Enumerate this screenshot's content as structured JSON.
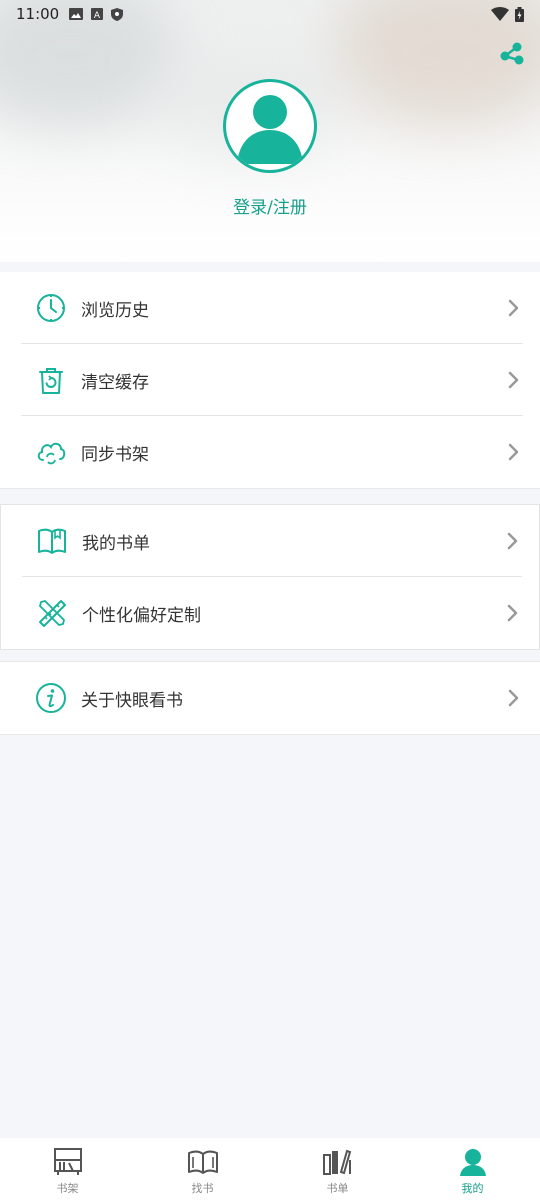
{
  "status_bar": {
    "time": "11:00",
    "left_icons": [
      "image-icon",
      "a-icon",
      "shield-icon"
    ],
    "right_icons": [
      "wifi-icon",
      "battery-icon"
    ]
  },
  "header": {
    "share_icon": "share-icon",
    "avatar_icon": "person-icon",
    "login_label": "登录/注册"
  },
  "menu_group_1": [
    {
      "icon": "clock-icon",
      "label": "浏览历史"
    },
    {
      "icon": "trash-icon",
      "label": "清空缓存"
    },
    {
      "icon": "cloud-sync-icon",
      "label": "同步书架"
    }
  ],
  "menu_group_2": [
    {
      "icon": "book-open-icon",
      "label": "我的书单"
    },
    {
      "icon": "pencil-ruler-icon",
      "label": "个性化偏好定制"
    }
  ],
  "menu_group_3": [
    {
      "icon": "info-icon",
      "label": "关于快眼看书"
    }
  ],
  "tabbar": {
    "tabs": [
      {
        "icon": "bookshelf-icon",
        "label": "书架",
        "active": false
      },
      {
        "icon": "open-book-icon",
        "label": "找书",
        "active": false
      },
      {
        "icon": "booklist-icon",
        "label": "书单",
        "active": false
      },
      {
        "icon": "profile-icon",
        "label": "我的",
        "active": true
      }
    ]
  },
  "colors": {
    "accent": "#17b39b",
    "accent_text": "#17a08b",
    "background": "#f5f6f9"
  }
}
